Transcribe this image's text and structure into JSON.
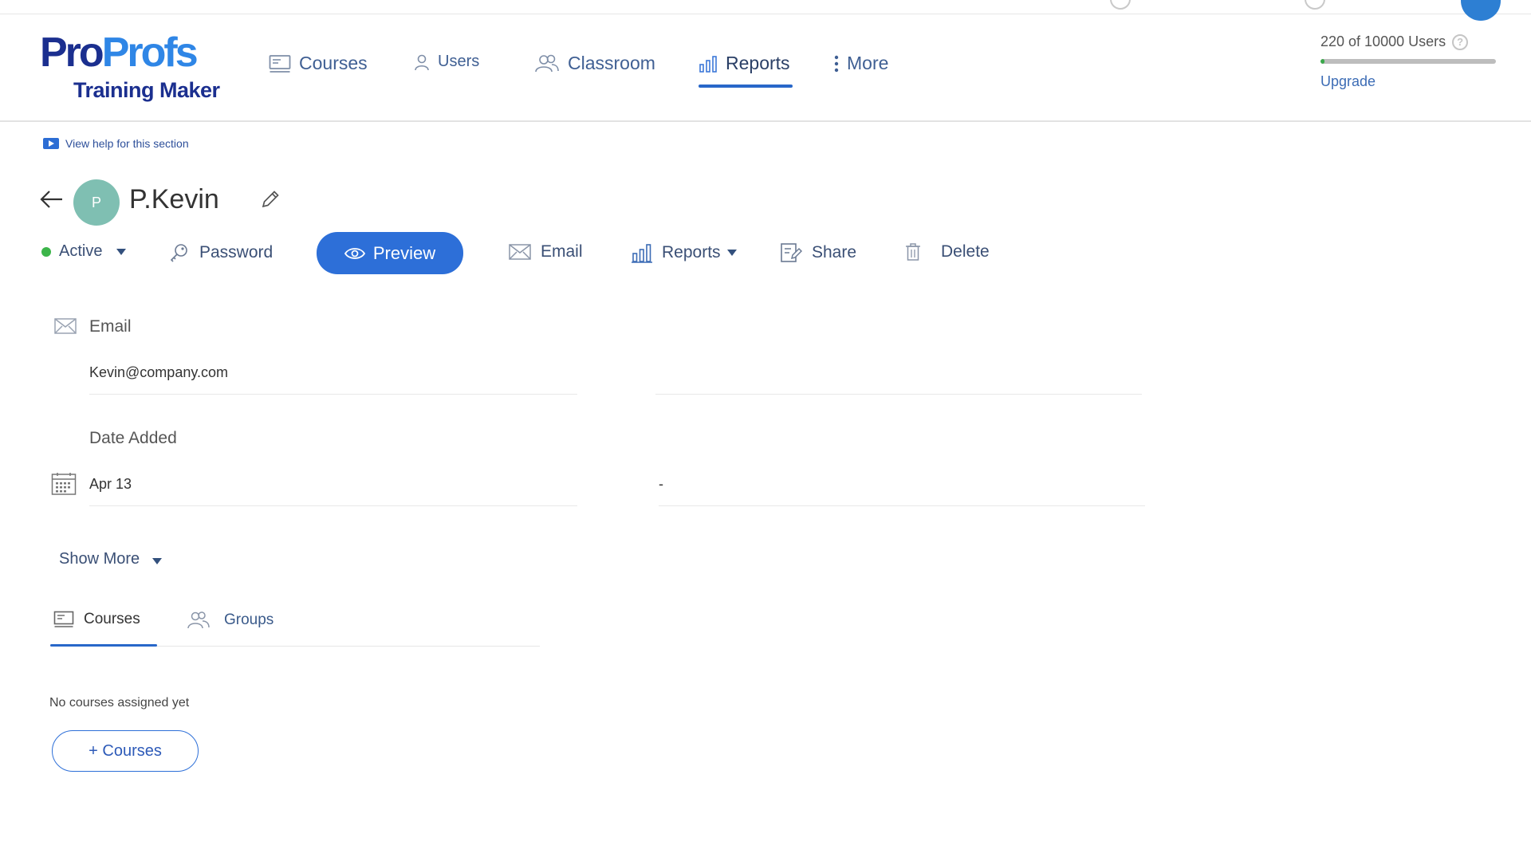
{
  "brand": {
    "logo_part1": "Pro",
    "logo_part2": "Profs",
    "logo_sub": "Training Maker"
  },
  "nav": {
    "items": [
      {
        "label": "Courses",
        "icon": "course-monitor-icon"
      },
      {
        "label": "Users",
        "icon": "user-icon"
      },
      {
        "label": "Classroom",
        "icon": "group-icon"
      },
      {
        "label": "Reports",
        "icon": "bar-chart-icon",
        "active": true
      },
      {
        "label": "More",
        "icon": "kebab-icon"
      }
    ]
  },
  "account": {
    "users_text": "220 of 10000 Users",
    "help_glyph": "?",
    "usage_fraction": 0.022,
    "upgrade_label": "Upgrade"
  },
  "help": {
    "link_text": "View help for this section"
  },
  "profile": {
    "avatar_initial": "P",
    "avatar_color": "#7fbfb2",
    "name": "P.Kevin"
  },
  "actions": {
    "status_label": "Active",
    "password_label": "Password",
    "preview_label": "Preview",
    "email_label": "Email",
    "reports_label": "Reports",
    "share_label": "Share",
    "delete_label": "Delete"
  },
  "details": {
    "email_label": "Email",
    "email_value": "Kevin@company.com",
    "date_label": "Date Added",
    "date_value": "Apr 13",
    "date_secondary": "-"
  },
  "show_more_label": "Show More",
  "tabs": [
    {
      "label": "Courses",
      "active": true
    },
    {
      "label": "Groups",
      "active": false
    }
  ],
  "courses": {
    "empty_message": "No courses assigned yet",
    "add_button_label": "+ Courses"
  },
  "colors": {
    "accent": "#2d6fd8",
    "active_status": "#3cb54a"
  }
}
